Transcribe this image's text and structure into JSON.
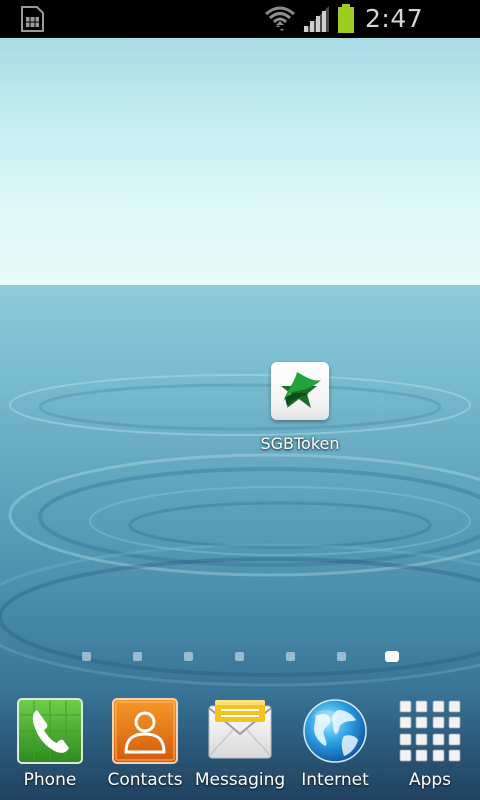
{
  "status_bar": {
    "time": "2:47 PM",
    "icons": [
      "sim-card-icon",
      "wifi-icon",
      "signal-icon",
      "battery-icon"
    ],
    "battery_color": "#9ccc1f"
  },
  "home_screen": {
    "shortcuts": [
      {
        "label": "SGBToken",
        "icon": "sgbtoken-star-icon"
      }
    ],
    "page_indicator": {
      "page_count": 7,
      "active_page": 7
    }
  },
  "dock": {
    "items": [
      {
        "label": "Phone",
        "icon": "phone-icon"
      },
      {
        "label": "Contacts",
        "icon": "contacts-icon"
      },
      {
        "label": "Messaging",
        "icon": "messaging-icon"
      },
      {
        "label": "Internet",
        "icon": "internet-globe-icon"
      },
      {
        "label": "Apps",
        "icon": "apps-grid-icon"
      }
    ]
  }
}
